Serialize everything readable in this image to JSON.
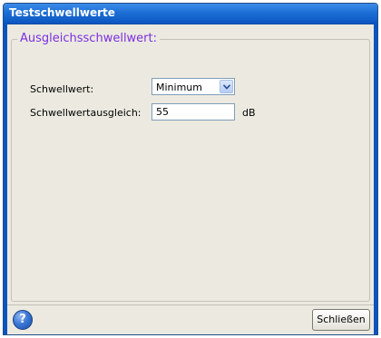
{
  "window": {
    "title": "Testschwellwerte"
  },
  "group": {
    "title": "Ausgleichsschwellwert:"
  },
  "threshold": {
    "label": "Schwellwert:",
    "selected": "Minimum"
  },
  "offset": {
    "label": "Schwellwertausgleich:",
    "value": "55",
    "unit": "dB"
  },
  "footer": {
    "help_glyph": "?",
    "close_label": "Schließen"
  },
  "icons": {
    "help": "help-icon",
    "dropdown": "chevron-down-icon"
  }
}
